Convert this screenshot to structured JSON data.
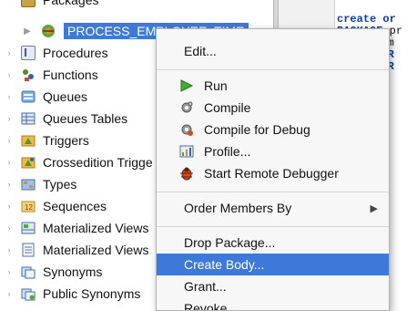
{
  "tree": {
    "partial_top": "Packages",
    "selected": "PROCESS_EMPLOYEE_TIME",
    "items": [
      {
        "label": "Procedures",
        "icon": "procedures-icon"
      },
      {
        "label": "Functions",
        "icon": "functions-icon"
      },
      {
        "label": "Queues",
        "icon": "queues-icon"
      },
      {
        "label": "Queues Tables",
        "icon": "queues-tables-icon"
      },
      {
        "label": "Triggers",
        "icon": "triggers-icon"
      },
      {
        "label": "Crossedition Trigge",
        "icon": "crossedition-triggers-icon"
      },
      {
        "label": "Types",
        "icon": "types-icon"
      },
      {
        "label": "Sequences",
        "icon": "sequences-icon"
      },
      {
        "label": "Materialized Views",
        "icon": "materialized-views-icon"
      },
      {
        "label": "Materialized Views",
        "icon": "materialized-views-logs-icon"
      },
      {
        "label": "Synonyms",
        "icon": "synonyms-icon"
      },
      {
        "label": "Public Synonyms",
        "icon": "public-synonyms-icon"
      }
    ]
  },
  "editor": {
    "line1_kw": "create or",
    "line2_kw": "PACKAGE",
    "line2_rest": " pr",
    "line3": "l_em",
    "line4": "EDUR",
    "line5": "EDUR"
  },
  "menu": {
    "edit": "Edit...",
    "run": "Run",
    "compile": "Compile",
    "compile_debug": "Compile for Debug",
    "profile": "Profile...",
    "remote_debugger": "Start Remote Debugger",
    "order_members": "Order Members By",
    "drop_package": "Drop Package...",
    "create_body": "Create Body...",
    "grant": "Grant...",
    "revoke": "Revoke..."
  },
  "colors": {
    "selection": "#3e79d9",
    "menu_bg": "#f7f7f7",
    "keyword": "#0b3db5"
  }
}
